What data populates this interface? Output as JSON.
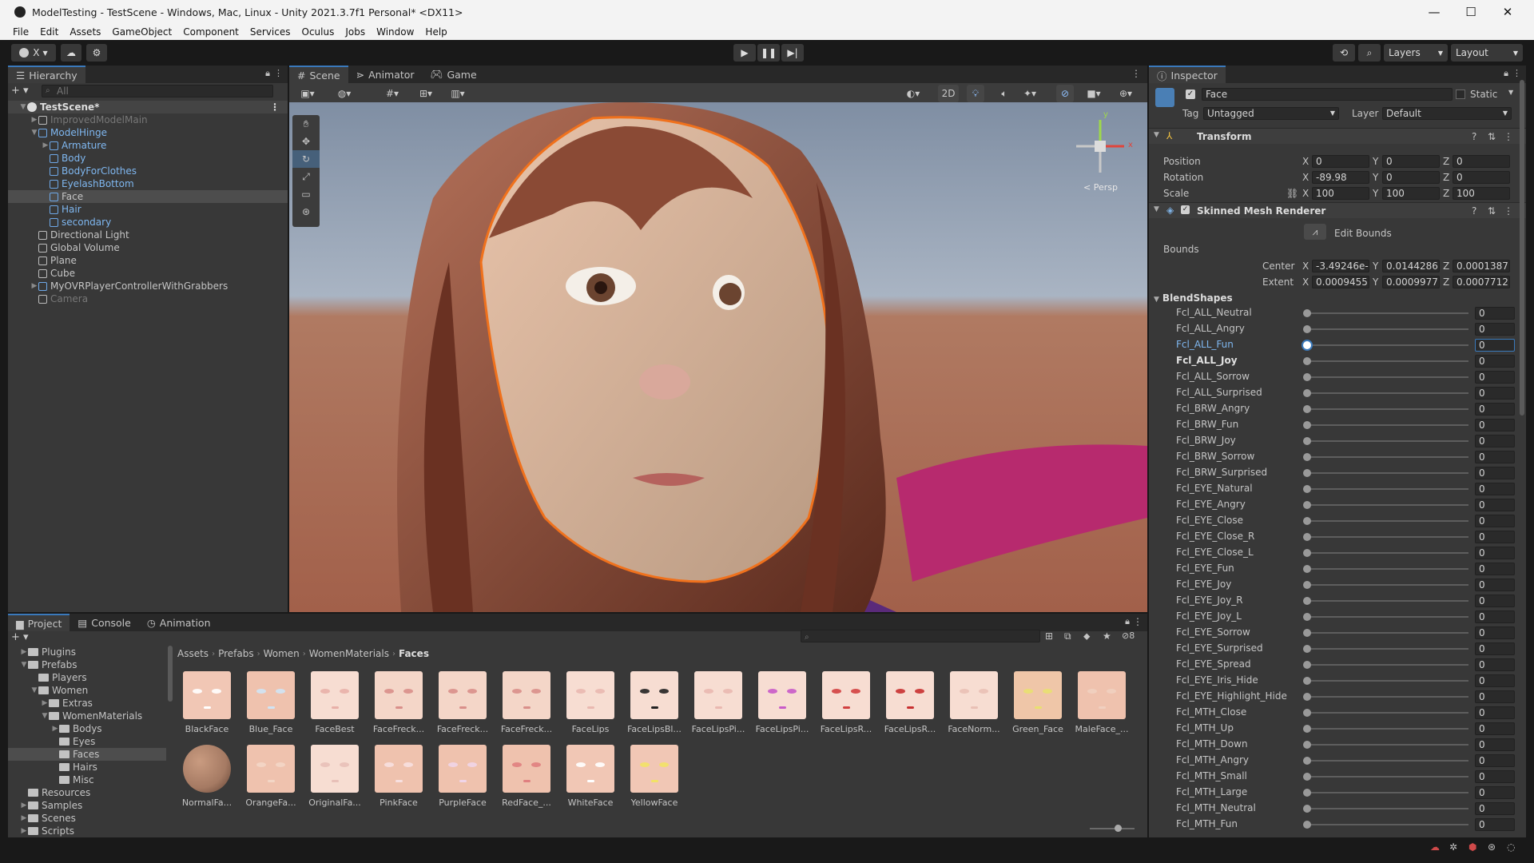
{
  "window": {
    "title": "ModelTesting - TestScene - Windows, Mac, Linux - Unity 2021.3.7f1 Personal* <DX11>",
    "minimize": "—",
    "maximize": "☐",
    "close": "✕"
  },
  "menu": [
    "File",
    "Edit",
    "Assets",
    "GameObject",
    "Component",
    "Services",
    "Oculus",
    "Jobs",
    "Window",
    "Help"
  ],
  "toolbar": {
    "account_label": "X",
    "layers_label": "Layers",
    "layout_label": "Layout"
  },
  "hierarchy": {
    "tab": "Hierarchy",
    "search_placeholder": "All",
    "items": [
      {
        "label": "TestScene*",
        "depth": 0,
        "arrow": "▼",
        "icon": "unity",
        "bold": true
      },
      {
        "label": "ImprovedModelMain",
        "depth": 1,
        "arrow": "▶",
        "icon": "cube",
        "dim": true
      },
      {
        "label": "ModelHinge",
        "depth": 1,
        "arrow": "▼",
        "icon": "blue",
        "blue": true
      },
      {
        "label": "Armature",
        "depth": 2,
        "arrow": "▶",
        "icon": "blue",
        "blue": true
      },
      {
        "label": "Body",
        "depth": 2,
        "arrow": "",
        "icon": "blue",
        "blue": true
      },
      {
        "label": "BodyForClothes",
        "depth": 2,
        "arrow": "",
        "icon": "blue",
        "blue": true
      },
      {
        "label": "EyelashBottom",
        "depth": 2,
        "arrow": "",
        "icon": "blue",
        "blue": true
      },
      {
        "label": "Face",
        "depth": 2,
        "arrow": "",
        "icon": "blue",
        "selected": true
      },
      {
        "label": "Hair",
        "depth": 2,
        "arrow": "",
        "icon": "blue",
        "blue": true
      },
      {
        "label": "secondary",
        "depth": 2,
        "arrow": "",
        "icon": "blue",
        "blue": true
      },
      {
        "label": "Directional Light",
        "depth": 1,
        "arrow": "",
        "icon": "cube"
      },
      {
        "label": "Global Volume",
        "depth": 1,
        "arrow": "",
        "icon": "cube"
      },
      {
        "label": "Plane",
        "depth": 1,
        "arrow": "",
        "icon": "cube"
      },
      {
        "label": "Cube",
        "depth": 1,
        "arrow": "",
        "icon": "cube"
      },
      {
        "label": "MyOVRPlayerControllerWithGrabbers",
        "depth": 1,
        "arrow": "▶",
        "icon": "blue"
      },
      {
        "label": "Camera",
        "depth": 1,
        "arrow": "",
        "icon": "cube",
        "dim": true
      }
    ]
  },
  "scene": {
    "tabs": [
      "Scene",
      "Animator",
      "Game"
    ],
    "toggle_2d": "2D",
    "persp_label": "< Persp",
    "gizmo_x": "x",
    "gizmo_y": "y"
  },
  "inspector": {
    "tab": "Inspector",
    "object_name": "Face",
    "static_label": "Static",
    "tag_label": "Tag",
    "tag_value": "Untagged",
    "layer_label": "Layer",
    "layer_value": "Default",
    "transform": {
      "title": "Transform",
      "position_label": "Position",
      "rotation_label": "Rotation",
      "scale_label": "Scale",
      "position": {
        "x": "0",
        "y": "0",
        "z": "0"
      },
      "rotation": {
        "x": "-89.98",
        "y": "0",
        "z": "0"
      },
      "scale": {
        "x": "100",
        "y": "100",
        "z": "100"
      }
    },
    "smr": {
      "title": "Skinned Mesh Renderer",
      "edit_bounds": "Edit Bounds",
      "bounds_label": "Bounds",
      "center_label": "Center",
      "extent_label": "Extent",
      "center": {
        "x": "-3.49246e-",
        "y": "0.0144286",
        "z": "0.0001387"
      },
      "extent": {
        "x": "0.0009455",
        "y": "0.0009977",
        "z": "0.0007712"
      }
    },
    "blendshapes_label": "BlendShapes",
    "blendshapes": [
      {
        "name": "Fcl_ALL_Neutral",
        "value": "0"
      },
      {
        "name": "Fcl_ALL_Angry",
        "value": "0"
      },
      {
        "name": "Fcl_ALL_Fun",
        "value": "0",
        "active": true
      },
      {
        "name": "Fcl_ALL_Joy",
        "value": "0",
        "bold": true
      },
      {
        "name": "Fcl_ALL_Sorrow",
        "value": "0"
      },
      {
        "name": "Fcl_ALL_Surprised",
        "value": "0"
      },
      {
        "name": "Fcl_BRW_Angry",
        "value": "0"
      },
      {
        "name": "Fcl_BRW_Fun",
        "value": "0"
      },
      {
        "name": "Fcl_BRW_Joy",
        "value": "0"
      },
      {
        "name": "Fcl_BRW_Sorrow",
        "value": "0"
      },
      {
        "name": "Fcl_BRW_Surprised",
        "value": "0"
      },
      {
        "name": "Fcl_EYE_Natural",
        "value": "0"
      },
      {
        "name": "Fcl_EYE_Angry",
        "value": "0"
      },
      {
        "name": "Fcl_EYE_Close",
        "value": "0"
      },
      {
        "name": "Fcl_EYE_Close_R",
        "value": "0"
      },
      {
        "name": "Fcl_EYE_Close_L",
        "value": "0"
      },
      {
        "name": "Fcl_EYE_Fun",
        "value": "0"
      },
      {
        "name": "Fcl_EYE_Joy",
        "value": "0"
      },
      {
        "name": "Fcl_EYE_Joy_R",
        "value": "0"
      },
      {
        "name": "Fcl_EYE_Joy_L",
        "value": "0"
      },
      {
        "name": "Fcl_EYE_Sorrow",
        "value": "0"
      },
      {
        "name": "Fcl_EYE_Surprised",
        "value": "0"
      },
      {
        "name": "Fcl_EYE_Spread",
        "value": "0"
      },
      {
        "name": "Fcl_EYE_Iris_Hide",
        "value": "0"
      },
      {
        "name": "Fcl_EYE_Highlight_Hide",
        "value": "0"
      },
      {
        "name": "Fcl_MTH_Close",
        "value": "0"
      },
      {
        "name": "Fcl_MTH_Up",
        "value": "0"
      },
      {
        "name": "Fcl_MTH_Down",
        "value": "0"
      },
      {
        "name": "Fcl_MTH_Angry",
        "value": "0"
      },
      {
        "name": "Fcl_MTH_Small",
        "value": "0"
      },
      {
        "name": "Fcl_MTH_Large",
        "value": "0"
      },
      {
        "name": "Fcl_MTH_Neutral",
        "value": "0"
      },
      {
        "name": "Fcl_MTH_Fun",
        "value": "0"
      }
    ]
  },
  "project": {
    "tabs": [
      "Project",
      "Console",
      "Animation"
    ],
    "hidden_count": "8",
    "breadcrumb": [
      "Assets",
      "Prefabs",
      "Women",
      "WomenMaterials",
      "Faces"
    ],
    "tree": [
      {
        "label": "Plugins",
        "depth": 1,
        "arrow": "▶"
      },
      {
        "label": "Prefabs",
        "depth": 1,
        "arrow": "▼"
      },
      {
        "label": "Players",
        "depth": 2,
        "arrow": ""
      },
      {
        "label": "Women",
        "depth": 2,
        "arrow": "▼"
      },
      {
        "label": "Extras",
        "depth": 3,
        "arrow": "▶"
      },
      {
        "label": "WomenMaterials",
        "depth": 3,
        "arrow": "▼"
      },
      {
        "label": "Bodys",
        "depth": 4,
        "arrow": "▶"
      },
      {
        "label": "Eyes",
        "depth": 4,
        "arrow": ""
      },
      {
        "label": "Faces",
        "depth": 4,
        "arrow": "",
        "selected": true
      },
      {
        "label": "Hairs",
        "depth": 4,
        "arrow": ""
      },
      {
        "label": "Misc",
        "depth": 4,
        "arrow": ""
      },
      {
        "label": "Resources",
        "depth": 1,
        "arrow": ""
      },
      {
        "label": "Samples",
        "depth": 1,
        "arrow": "▶"
      },
      {
        "label": "Scenes",
        "depth": 1,
        "arrow": "▶"
      },
      {
        "label": "Scripts",
        "depth": 1,
        "arrow": "▶"
      }
    ],
    "assets": [
      {
        "label": "BlackFace",
        "tint": "#f1c7b5",
        "mark": "#ffffff"
      },
      {
        "label": "Blue_Face",
        "tint": "#efc2ae",
        "mark": "#cfe4f5"
      },
      {
        "label": "FaceBest",
        "tint": "#f7ddd2",
        "mark": "#e8b0a8"
      },
      {
        "label": "FaceFreck...",
        "tint": "#f4d6c8",
        "mark": "#d98f8a"
      },
      {
        "label": "FaceFreck...",
        "tint": "#f4d6c8",
        "mark": "#d98f8a"
      },
      {
        "label": "FaceFreck...",
        "tint": "#f4d6c8",
        "mark": "#d98f8a"
      },
      {
        "label": "FaceLips",
        "tint": "#f7ddd2",
        "mark": "#e9b8b0"
      },
      {
        "label": "FaceLipsBl...",
        "tint": "#f7ddd2",
        "mark": "#222222"
      },
      {
        "label": "FaceLipsPi...",
        "tint": "#f7ddd2",
        "mark": "#e9b8b0"
      },
      {
        "label": "FaceLipsPi...",
        "tint": "#f7ddd2",
        "mark": "#c85ac8"
      },
      {
        "label": "FaceLipsR...",
        "tint": "#f7ddd2",
        "mark": "#d14040"
      },
      {
        "label": "FaceLipsR...",
        "tint": "#f7ddd2",
        "mark": "#c83030"
      },
      {
        "label": "FaceNorm...",
        "tint": "#f7ddd2",
        "mark": "#e9c0b5"
      },
      {
        "label": "Green_Face",
        "tint": "#efc6a8",
        "mark": "#e8e070"
      },
      {
        "label": "MaleFace_...",
        "tint": "#efc2ae",
        "mark": "#f0d0c0"
      },
      {
        "label": "NormalFa...",
        "tint": "#a57a63",
        "mark": "#8a5f48",
        "sphere": true
      },
      {
        "label": "OrangeFa...",
        "tint": "#efc2ae",
        "mark": "#f3d6c6"
      },
      {
        "label": "OriginalFa...",
        "tint": "#f7ddd2",
        "mark": "#e8c0b8"
      },
      {
        "label": "PinkFace",
        "tint": "#efc2ae",
        "mark": "#f7e0e0"
      },
      {
        "label": "PurpleFace",
        "tint": "#efc2ae",
        "mark": "#f0d5e8"
      },
      {
        "label": "RedFace_...",
        "tint": "#efc2ae",
        "mark": "#e08080"
      },
      {
        "label": "WhiteFace",
        "tint": "#f1c7b5",
        "mark": "#ffffff"
      },
      {
        "label": "YellowFace",
        "tint": "#f1c7b5",
        "mark": "#f2e266"
      }
    ]
  },
  "colors": {
    "accent": "#3a79bb",
    "selection": "#2c5d87",
    "panel": "#383838",
    "dark": "#282828"
  }
}
